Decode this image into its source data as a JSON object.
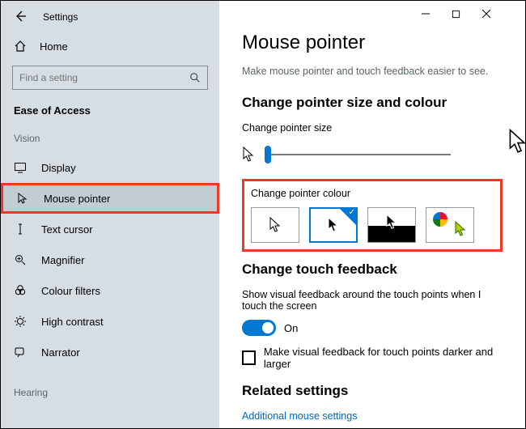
{
  "app_title": "Settings",
  "home_label": "Home",
  "search_placeholder": "Find a setting",
  "category_title": "Ease of Access",
  "groups": {
    "vision_label": "Vision",
    "hearing_label": "Hearing"
  },
  "nav": {
    "display": "Display",
    "mouse_pointer": "Mouse pointer",
    "text_cursor": "Text cursor",
    "magnifier": "Magnifier",
    "colour_filters": "Colour filters",
    "high_contrast": "High contrast",
    "narrator": "Narrator"
  },
  "page": {
    "title": "Mouse pointer",
    "subtitle": "Make mouse pointer and touch feedback easier to see.",
    "section_size_colour": "Change pointer size and colour",
    "label_size": "Change pointer size",
    "label_colour": "Change pointer colour",
    "section_touch": "Change touch feedback",
    "touch_desc": "Show visual feedback around the touch points when I touch the screen",
    "toggle_state": "On",
    "checkbox_label": "Make visual feedback for touch points darker and larger",
    "section_related": "Related settings",
    "link_additional": "Additional mouse settings"
  },
  "pointer_colour_options": [
    {
      "id": "white",
      "selected": false
    },
    {
      "id": "black",
      "selected": true
    },
    {
      "id": "inverted",
      "selected": false
    },
    {
      "id": "custom",
      "selected": false
    }
  ],
  "colours": {
    "accent": "#0078d4",
    "annotation": "#ee3a1f"
  }
}
